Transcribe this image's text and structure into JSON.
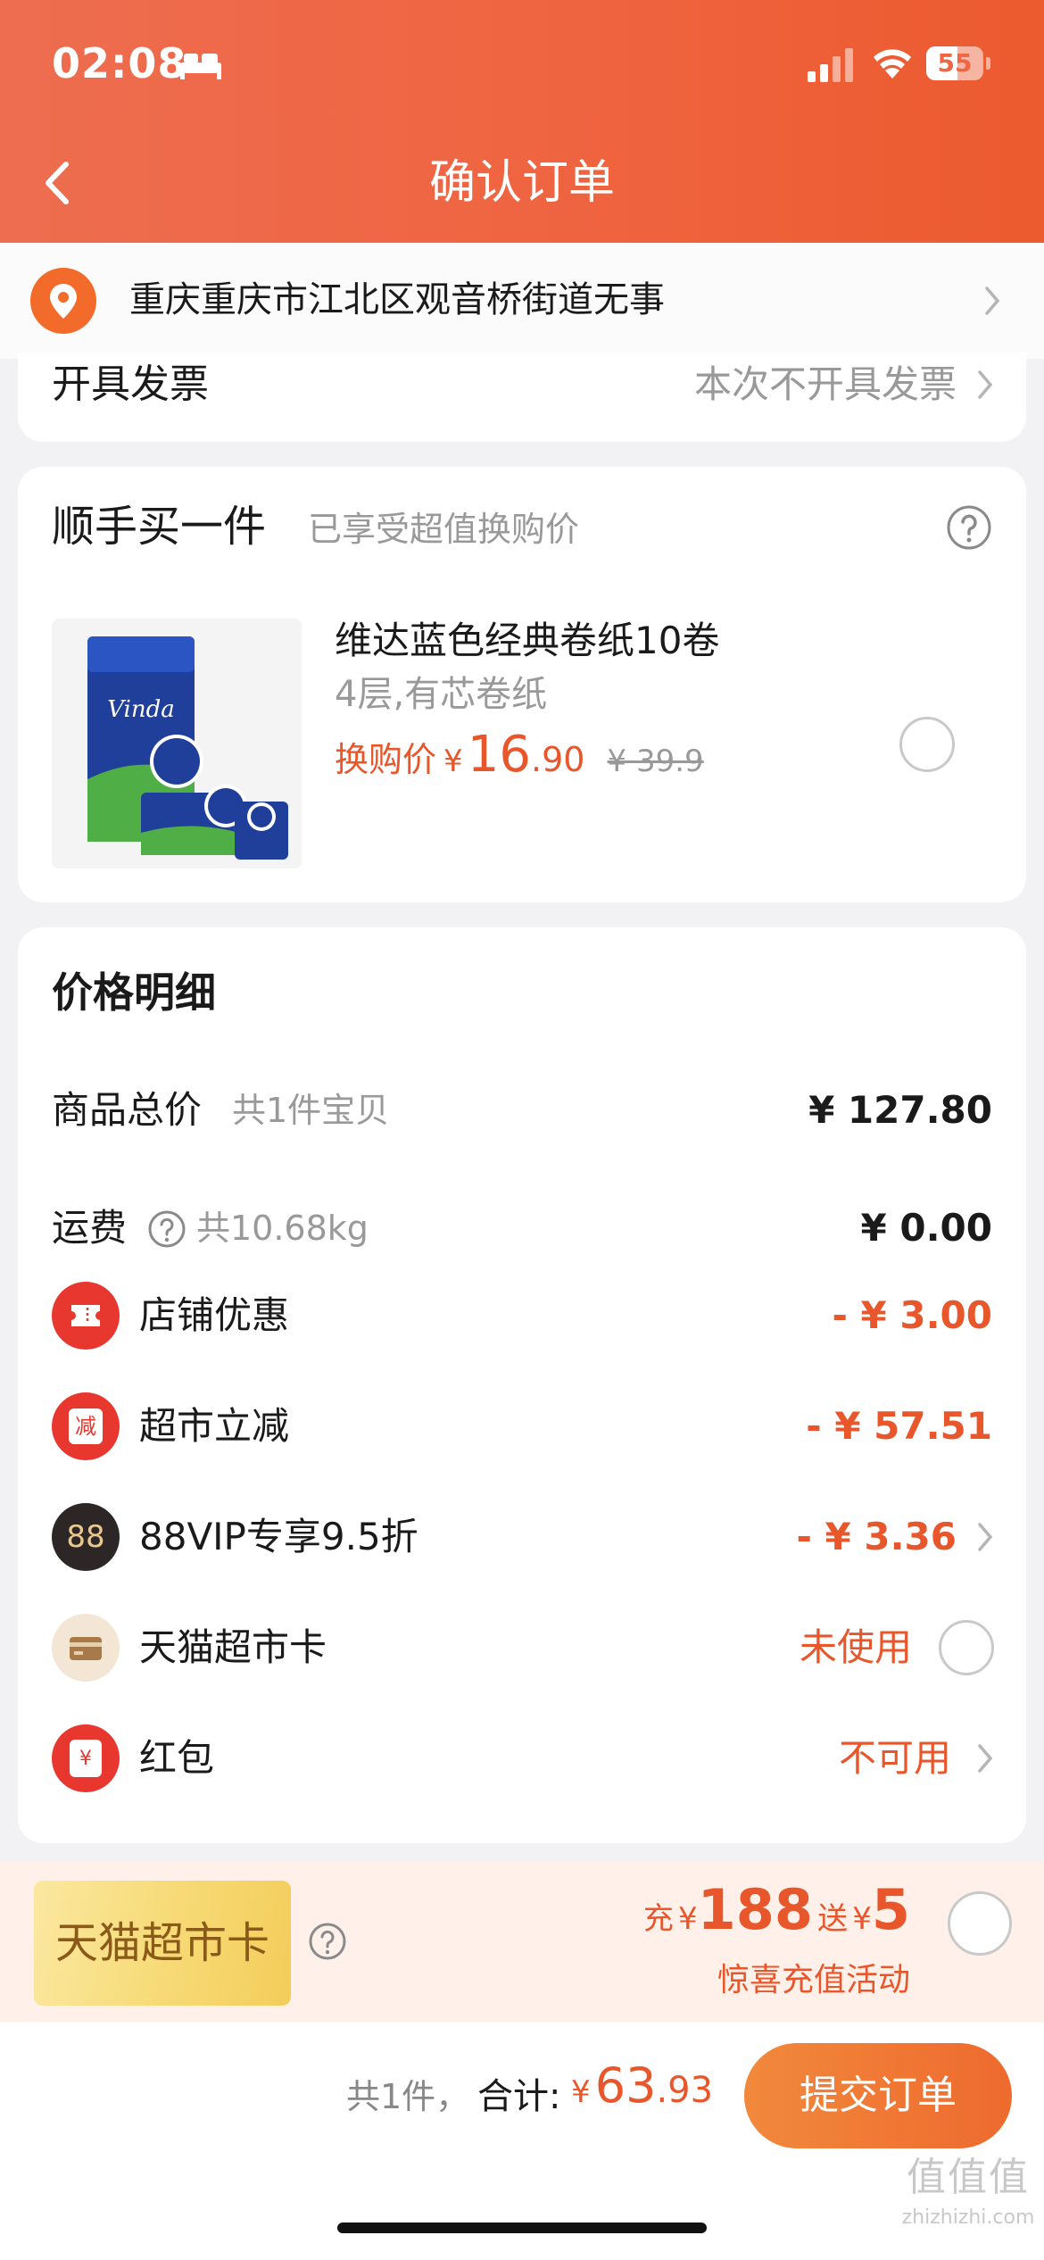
{
  "status_bar": {
    "time": "02:08",
    "battery": "55",
    "battery_level": 0.55
  },
  "header": {
    "title": "确认订单"
  },
  "address": {
    "text": "重庆重庆市江北区观音桥街道无事"
  },
  "invoice": {
    "label": "开具发票",
    "value": "本次不开具发票"
  },
  "addon": {
    "title": "顺手买一件",
    "subtitle": "已享受超值换购价",
    "product": {
      "name": "维达蓝色经典卷纸10卷",
      "spec": "4层,有芯卷纸",
      "price_label": "换购价",
      "yen": "¥",
      "price_int": "16",
      "price_dec": ".90",
      "old_price": "¥ 39.9"
    }
  },
  "price_detail": {
    "title": "价格明细",
    "goods": {
      "label": "商品总价",
      "sub": "共1件宝贝",
      "amount": "¥ 127.80"
    },
    "shipping": {
      "label": "运费",
      "sub": "共10.68kg",
      "amount": "¥ 0.00"
    },
    "shop_discount": {
      "label": "店铺优惠",
      "amount": "- ¥ 3.00"
    },
    "market_cut": {
      "label": "超市立减",
      "amount": "- ¥ 57.51",
      "icon_text": "减"
    },
    "vip": {
      "label": "88VIP专享9.5折",
      "amount": "- ¥ 3.36",
      "icon_text": "88"
    },
    "market_card": {
      "label": "天猫超市卡",
      "status": "未使用"
    },
    "red_packet": {
      "label": "红包",
      "status": "不可用",
      "icon_text": "¥"
    }
  },
  "promo": {
    "card_text": "天猫超市卡",
    "charge_label": "充",
    "charge_yen": "¥",
    "charge_amount": "188",
    "gift_label": "送",
    "gift_yen": "¥",
    "gift_amount": "5",
    "sub": "惊喜充值活动"
  },
  "footer": {
    "count": "共1件，",
    "total_label": "合计:",
    "yen": "¥",
    "total_int": "63",
    "total_dec": ".93",
    "submit": "提交订单"
  },
  "watermark": {
    "logo": "值值值",
    "url": "zhizhizhi.com"
  },
  "colors": {
    "accent": "#e8562b",
    "header_start": "#ee6d50",
    "header_end": "#ec5a2f",
    "button": "#ee6a2e"
  }
}
